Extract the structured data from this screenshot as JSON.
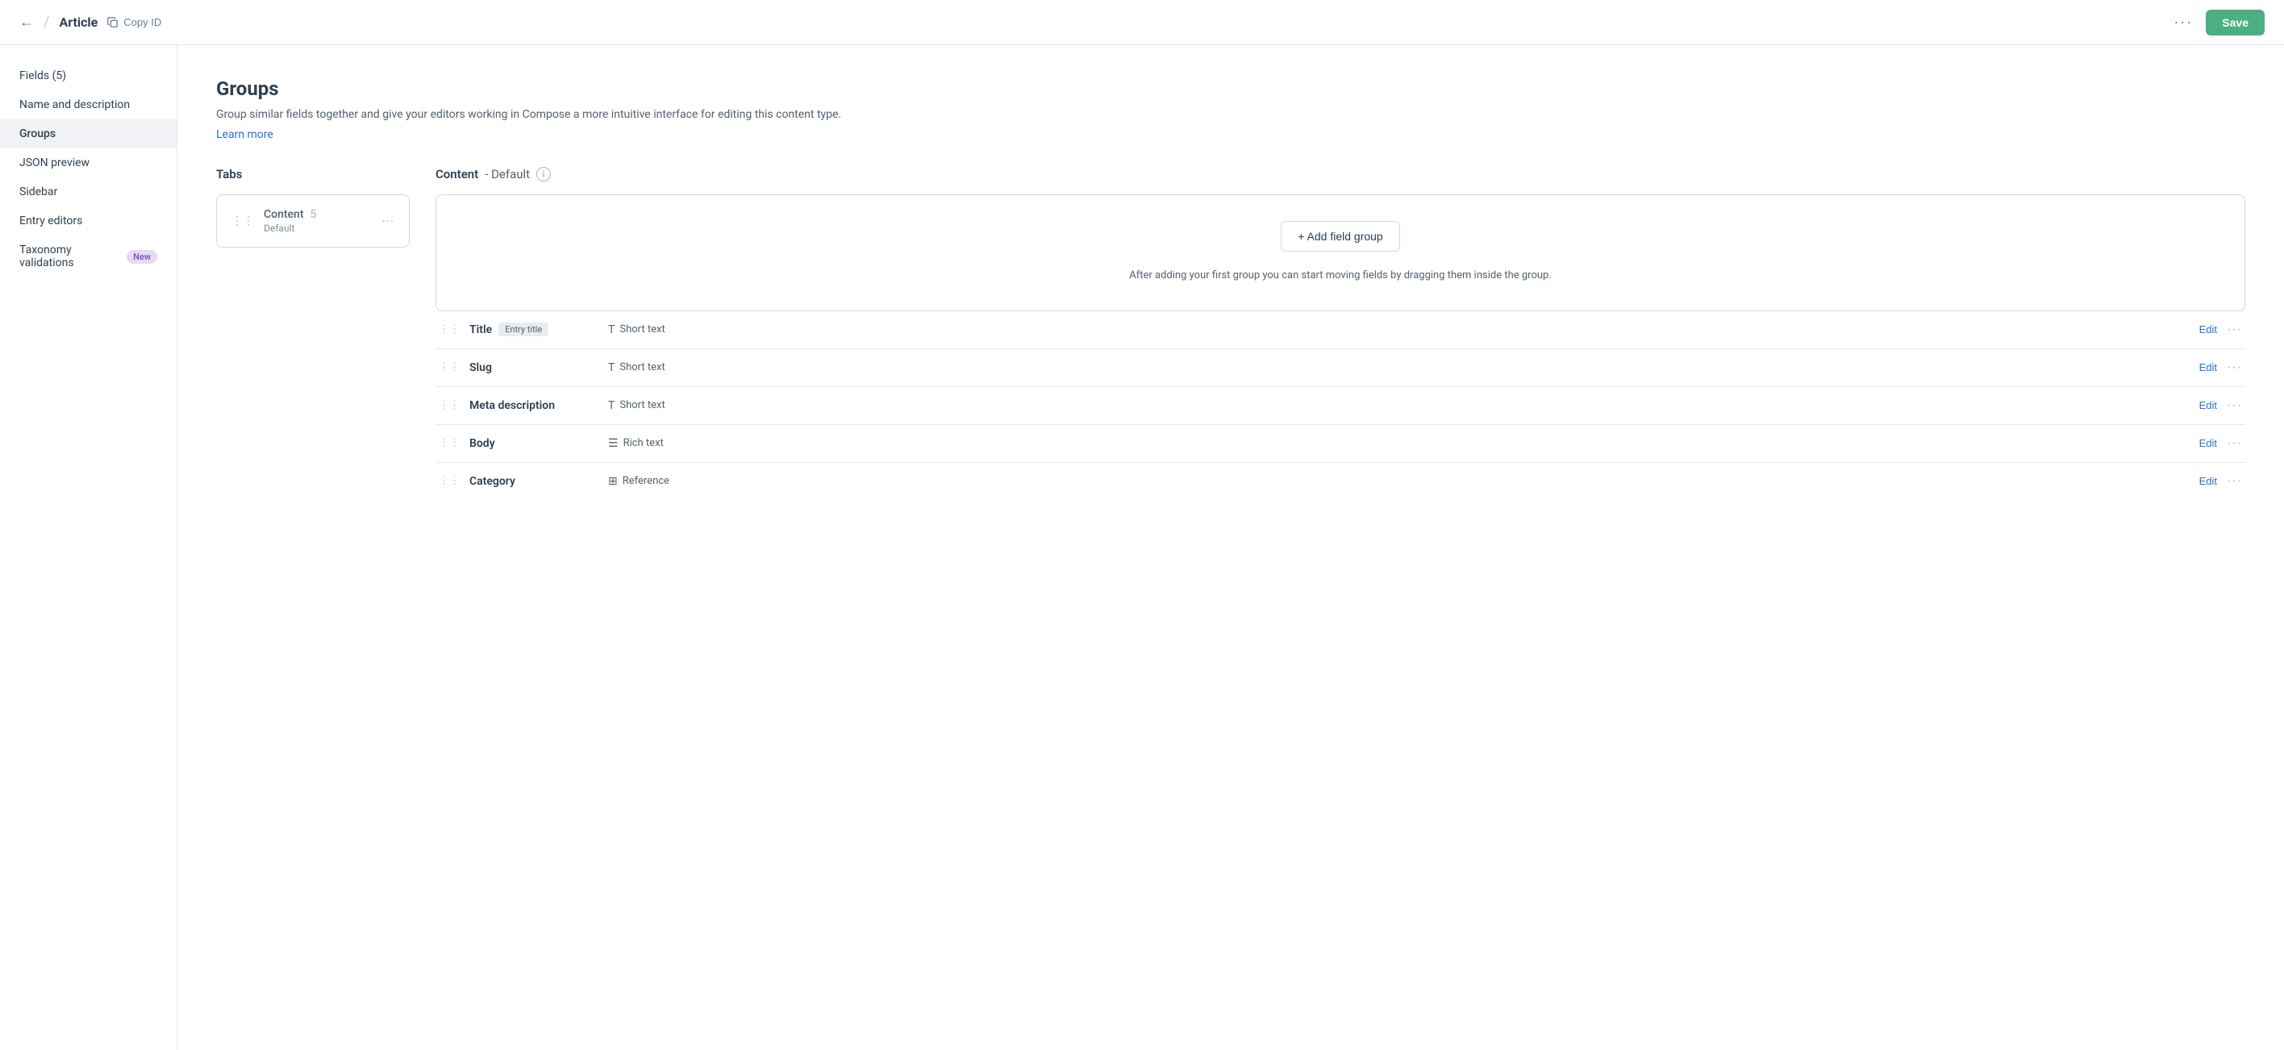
{
  "topbar": {
    "back_icon": "←",
    "title": "Article",
    "copy_id_label": "Copy ID",
    "more_icon": "···",
    "save_label": "Save"
  },
  "sidebar": {
    "items": [
      {
        "id": "fields",
        "label": "Fields (5)",
        "active": false
      },
      {
        "id": "name",
        "label": "Name and description",
        "active": false
      },
      {
        "id": "groups",
        "label": "Groups",
        "active": true
      },
      {
        "id": "json",
        "label": "JSON preview",
        "active": false
      },
      {
        "id": "sidebar",
        "label": "Sidebar",
        "active": false
      },
      {
        "id": "entry-editors",
        "label": "Entry editors",
        "active": false
      },
      {
        "id": "taxonomy",
        "label": "Taxonomy validations",
        "active": false,
        "badge": "New"
      }
    ]
  },
  "main": {
    "title": "Groups",
    "description": "Group similar fields together and give your editors working in Compose a more intuitive interface for editing this content type.",
    "learn_more": "Learn more",
    "tabs_label": "Tabs",
    "content_tab": {
      "name": "Content",
      "count": "5",
      "default_label": "Default",
      "header_label": "Content",
      "header_sub": "- Default"
    },
    "add_field_group_btn": "+ Add field group",
    "add_group_hint": "After adding your first group you can start moving fields by dragging them inside the group.",
    "fields": [
      {
        "name": "Title",
        "badge": "Entry title",
        "type": "Short text",
        "type_icon": "T"
      },
      {
        "name": "Slug",
        "badge": null,
        "type": "Short text",
        "type_icon": "T"
      },
      {
        "name": "Meta description",
        "badge": null,
        "type": "Short text",
        "type_icon": "T"
      },
      {
        "name": "Body",
        "badge": null,
        "type": "Rich text",
        "type_icon": "☰"
      },
      {
        "name": "Category",
        "badge": null,
        "type": "Reference",
        "type_icon": "⊞"
      }
    ],
    "edit_label": "Edit"
  }
}
